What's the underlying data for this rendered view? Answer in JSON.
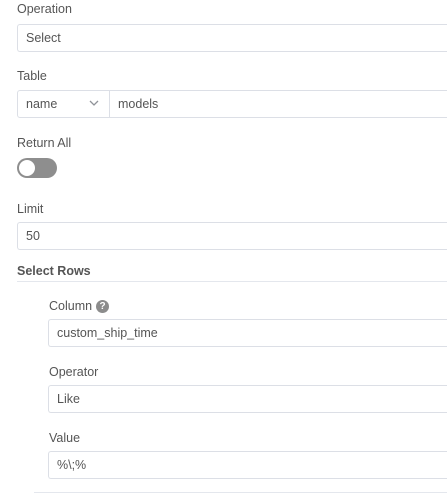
{
  "operation": {
    "label": "Operation",
    "value": "Select"
  },
  "table": {
    "label": "Table",
    "mode": "name",
    "value": "models"
  },
  "return_all": {
    "label": "Return All",
    "enabled": false
  },
  "limit": {
    "label": "Limit",
    "value": "50"
  },
  "select_rows": {
    "title": "Select Rows",
    "column": {
      "label": "Column",
      "value": "custom_ship_time",
      "help_icon": "?"
    },
    "operator": {
      "label": "Operator",
      "value": "Like"
    },
    "value": {
      "label": "Value",
      "value": "%\\;%"
    }
  },
  "icons": {
    "dropdown": "chevron-down-icon",
    "help": "question-circle-icon",
    "toggle": "toggle-switch"
  },
  "colors": {
    "toggle_off": "#8e8e8e",
    "border": "#dcdfe6",
    "text": "#555555"
  }
}
